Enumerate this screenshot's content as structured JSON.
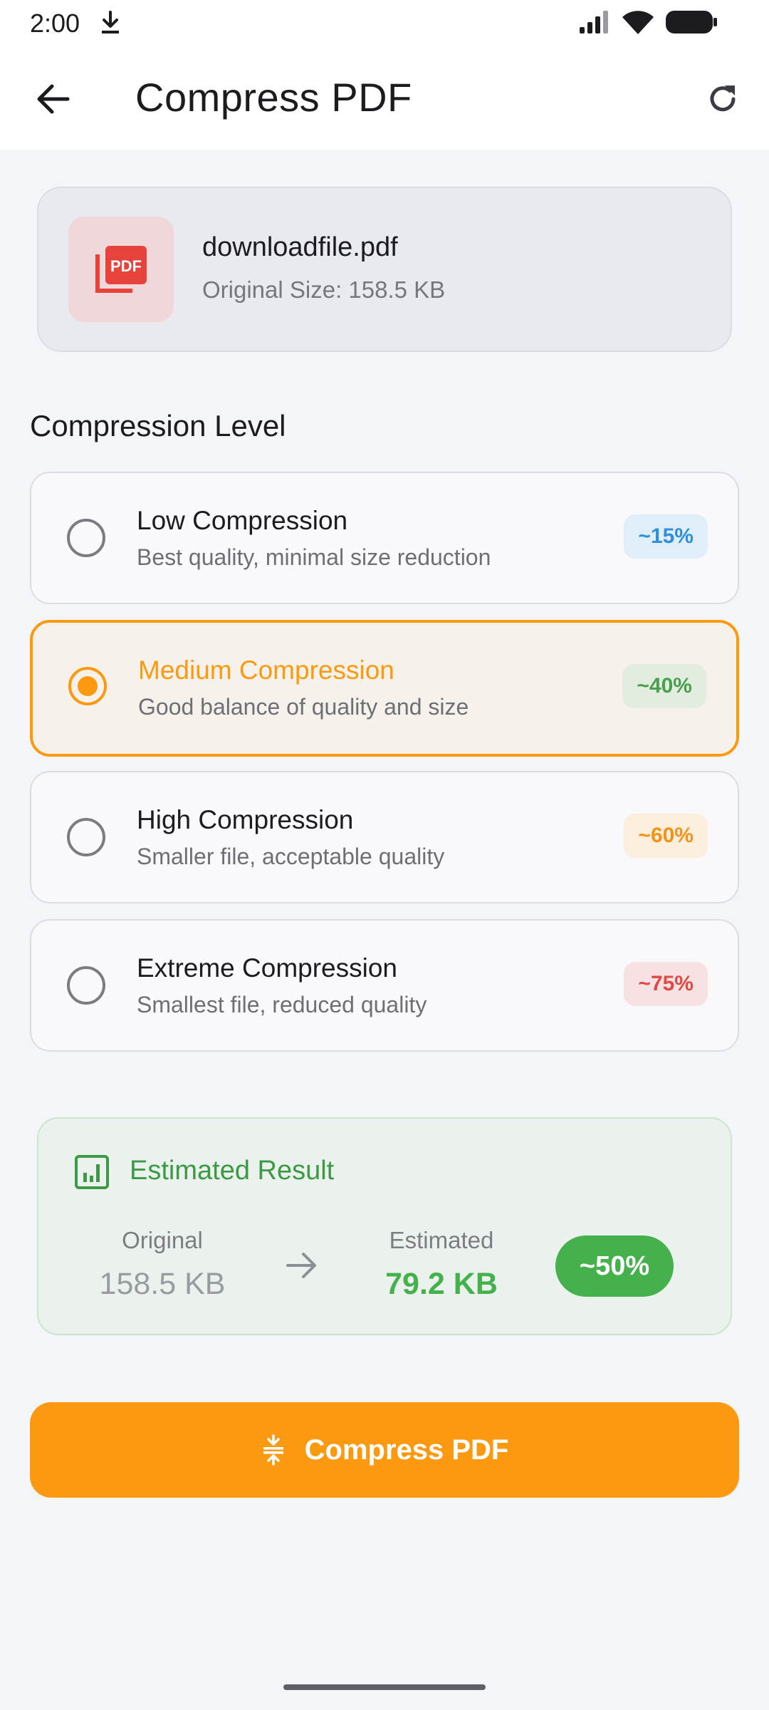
{
  "status_bar": {
    "time": "2:00"
  },
  "app_bar": {
    "title": "Compress PDF",
    "back_icon": "arrow-left-icon",
    "refresh_icon": "refresh-icon"
  },
  "file": {
    "name": "downloadfile.pdf",
    "size_label": "Original Size: 158.5 KB",
    "icon": "pdf-file-icon",
    "icon_text": "PDF"
  },
  "compression": {
    "section_title": "Compression Level",
    "options": [
      {
        "title": "Low Compression",
        "description": "Best quality, minimal size reduction",
        "badge": "~15%",
        "selected": false,
        "badge_color": "#2f8fd8",
        "badge_bg": "#e0eefa"
      },
      {
        "title": "Medium Compression",
        "description": "Good balance of quality and size",
        "badge": "~40%",
        "selected": true,
        "badge_color": "#4a9f4f",
        "badge_bg": "#e2ede0"
      },
      {
        "title": "High Compression",
        "description": "Smaller file, acceptable quality",
        "badge": "~60%",
        "selected": false,
        "badge_color": "#f09419",
        "badge_bg": "#fbeedd"
      },
      {
        "title": "Extreme Compression",
        "description": "Smallest file, reduced quality",
        "badge": "~75%",
        "selected": false,
        "badge_color": "#de4a45",
        "badge_bg": "#f8e1e3"
      }
    ]
  },
  "result": {
    "title": "Estimated Result",
    "original_label": "Original",
    "original_value": "158.5 KB",
    "estimated_label": "Estimated",
    "estimated_value": "79.2 KB",
    "savings": "~50%",
    "icon": "bar-chart-icon"
  },
  "action": {
    "label": "Compress PDF",
    "icon": "compress-icon"
  },
  "colors": {
    "accent": "#fb9a10",
    "success": "#45b14c",
    "pdf_red": "#e5433c"
  }
}
